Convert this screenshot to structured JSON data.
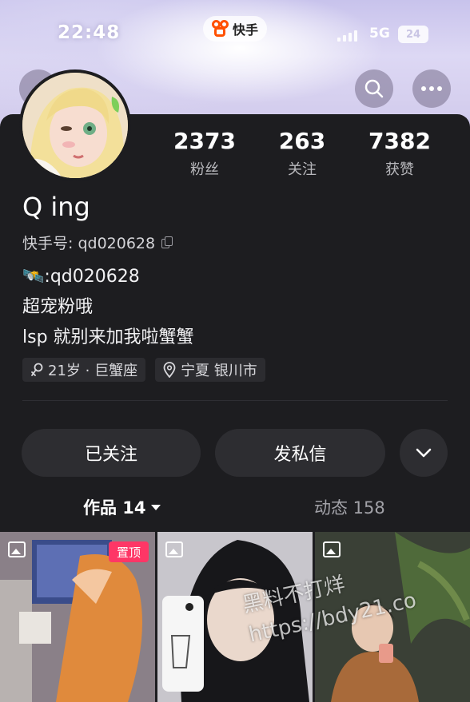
{
  "status_bar": {
    "time": "22:48",
    "app_name": "快手",
    "network": "5G",
    "battery": "24"
  },
  "colors": {
    "brand": "#ff5000",
    "pinned_badge": "#fe3666",
    "card_bg": "#1d1d20",
    "button_bg": "#2d2d31"
  },
  "header": {
    "back_icon": "chevron-left-icon",
    "search_icon": "search-icon",
    "more_icon": "more-dots-icon"
  },
  "profile": {
    "stats": [
      {
        "value": "2373",
        "label": "粉丝"
      },
      {
        "value": "263",
        "label": "关注"
      },
      {
        "value": "7382",
        "label": "获赞"
      }
    ],
    "nickname": "Q ing",
    "kuaishou_id_label": "快手号: ",
    "kuaishou_id": "qd020628",
    "bio": {
      "line1_emoji": "🛰️",
      "line1": ":qd020628",
      "line2": "超宠粉哦",
      "line3": "lsp 就别来加我啦蟹蟹"
    },
    "tags": [
      {
        "icon": "gender-female-icon",
        "text": "21岁 · 巨蟹座"
      },
      {
        "icon": "location-pin-icon",
        "text": "宁夏 银川市"
      }
    ]
  },
  "actions": {
    "followed": "已关注",
    "message": "发私信",
    "expand_icon": "chevron-down-icon"
  },
  "tabs": {
    "works": "作品 14",
    "moments": "动态 158"
  },
  "grid": {
    "pinned_label": "置顶",
    "watermark_line1": "黑料不打烊",
    "watermark_line2": "https://bdy21.co"
  }
}
